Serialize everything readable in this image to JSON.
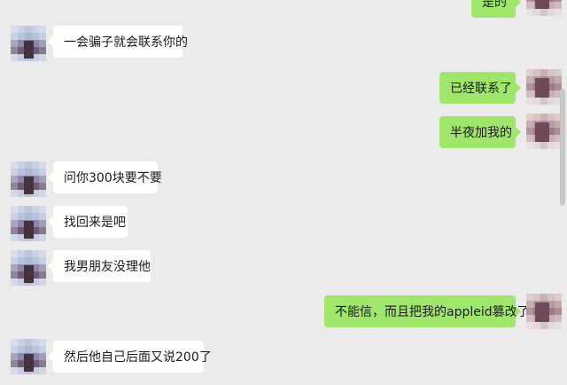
{
  "messages": [
    {
      "side": "right",
      "text": "是的"
    },
    {
      "side": "left",
      "text": "一会骗子就会联系你的"
    },
    {
      "side": "right",
      "text": "已经联系了"
    },
    {
      "side": "right",
      "text": "半夜加我的"
    },
    {
      "side": "left",
      "text": "问你300块要不要"
    },
    {
      "side": "left",
      "text": "找回来是吧"
    },
    {
      "side": "left",
      "text": "我男朋友没理他"
    },
    {
      "side": "right",
      "text": "不能信，而且把我的appleid篡改了"
    },
    {
      "side": "left",
      "text": "然后他自己后面又说200了"
    }
  ],
  "colors": {
    "background": "#ebebeb",
    "incoming_bubble": "#ffffff",
    "outgoing_bubble": "#9fe66b"
  }
}
